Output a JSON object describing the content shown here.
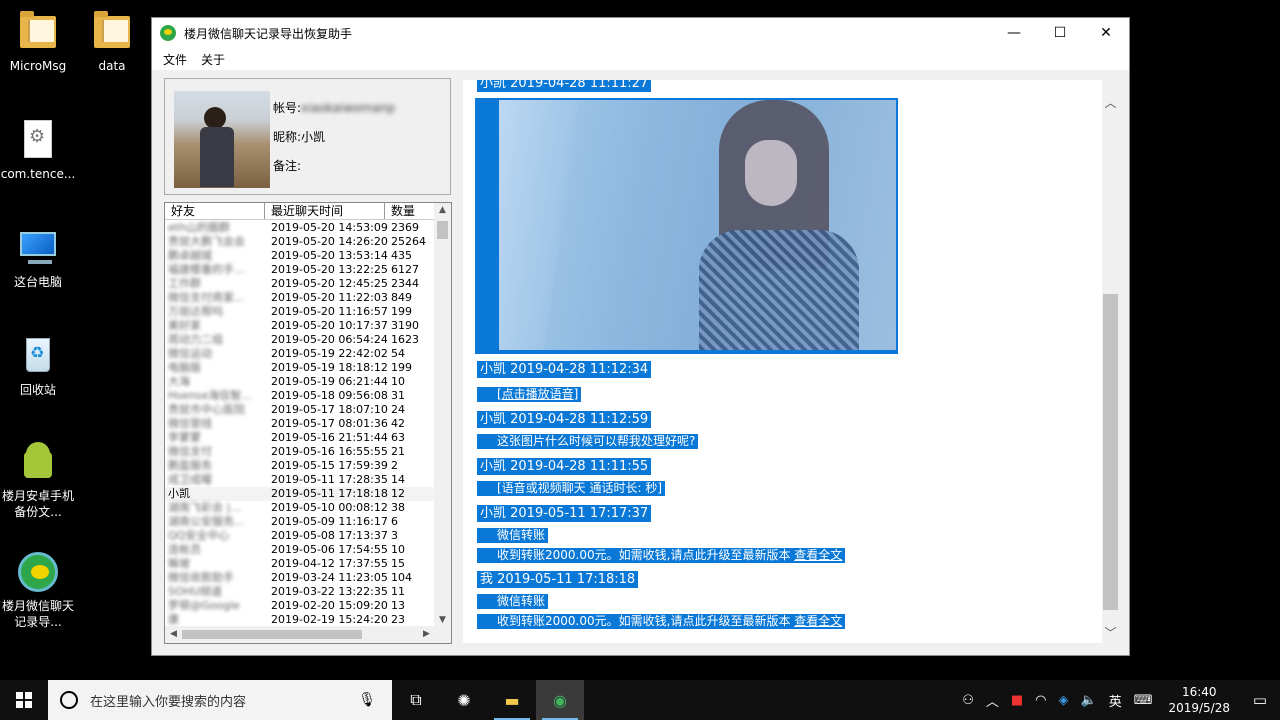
{
  "desktop": {
    "icons": [
      {
        "label": "MicroMsg",
        "icon": "folder-icon"
      },
      {
        "label": "data",
        "icon": "folder-icon"
      },
      {
        "label": "com.tence...",
        "icon": "file-icon"
      },
      {
        "label": "这台电脑",
        "icon": "computer-icon"
      },
      {
        "label": "回收站",
        "icon": "recycle-bin-icon"
      },
      {
        "label": "楼月安卓手机备份文...",
        "icon": "android-icon"
      },
      {
        "label": "楼月微信聊天记录导...",
        "icon": "wechat-recovery-icon"
      }
    ]
  },
  "window": {
    "title": "楼月微信聊天记录导出恢复助手",
    "controls": {
      "minimize": "—",
      "maximize": "☐",
      "close": "✕"
    },
    "menu": [
      "文件",
      "关于"
    ]
  },
  "profile": {
    "account_label": "帐号:",
    "account_value": "xiaokaiwomanp",
    "nickname_label": "昵称:",
    "nickname_value": "小凯",
    "remark_label": "备注:",
    "remark_value": ""
  },
  "friend_list": {
    "columns": [
      "好友",
      "最近聊天时间",
      "数量"
    ],
    "rows": [
      {
        "name": "eth山的圈群",
        "time": "2019-05-20 14:53:09",
        "count": "2369",
        "blurred": true
      },
      {
        "name": "贵就大鹏飞会会",
        "time": "2019-05-20 14:26:20",
        "count": "25264",
        "blurred": true
      },
      {
        "name": "鹏卓越城",
        "time": "2019-05-20 13:53:14",
        "count": "435",
        "blurred": true
      },
      {
        "name": "福建樱番的手...",
        "time": "2019-05-20 13:22:25",
        "count": "6127",
        "blurred": true
      },
      {
        "name": "工作群",
        "time": "2019-05-20 12:45:25",
        "count": "2344",
        "blurred": true
      },
      {
        "name": "微信支付商家...",
        "time": "2019-05-20 11:22:03",
        "count": "849",
        "blurred": true
      },
      {
        "name": "万丽达帮吗",
        "time": "2019-05-20 11:16:57",
        "count": "199",
        "blurred": true
      },
      {
        "name": "美好家",
        "time": "2019-05-20 10:17:37",
        "count": "3190",
        "blurred": true
      },
      {
        "name": "周动力二组",
        "time": "2019-05-20 06:54:24",
        "count": "1623",
        "blurred": true
      },
      {
        "name": "微信运动",
        "time": "2019-05-19 22:42:02",
        "count": "54",
        "blurred": true
      },
      {
        "name": "电脑版",
        "time": "2019-05-19 18:18:12",
        "count": "199",
        "blurred": true
      },
      {
        "name": "大海",
        "time": "2019-05-19 06:21:44",
        "count": "10",
        "blurred": true
      },
      {
        "name": "Hsense海信智...",
        "time": "2019-05-18 09:56:08",
        "count": "31",
        "blurred": true
      },
      {
        "name": "贵就市中心医院",
        "time": "2019-05-17 18:07:10",
        "count": "24",
        "blurred": true
      },
      {
        "name": "微信管线",
        "time": "2019-05-17 08:01:36",
        "count": "42",
        "blurred": true
      },
      {
        "name": "李蒙蒙",
        "time": "2019-05-16 21:51:44",
        "count": "63",
        "blurred": true
      },
      {
        "name": "微信支付",
        "time": "2019-05-16 16:55:55",
        "count": "21",
        "blurred": true
      },
      {
        "name": "鹏盈服务",
        "time": "2019-05-15 17:59:39",
        "count": "2",
        "blurred": true
      },
      {
        "name": "成卫成曜",
        "time": "2019-05-11 17:28:35",
        "count": "14",
        "blurred": true
      },
      {
        "name": "小凯",
        "time": "2019-05-11 17:18:18",
        "count": "12",
        "blurred": false,
        "selected": true
      },
      {
        "name": "湖南飞彩会 |...",
        "time": "2019-05-10 00:08:12",
        "count": "38",
        "blurred": true
      },
      {
        "name": "湖南公安服务...",
        "time": "2019-05-09 11:16:17",
        "count": "6",
        "blurred": true
      },
      {
        "name": "QQ安全中心",
        "time": "2019-05-08 17:13:37",
        "count": "3",
        "blurred": true
      },
      {
        "name": "连帐员",
        "time": "2019-05-06 17:54:55",
        "count": "10",
        "blurred": true
      },
      {
        "name": "嘛坡",
        "time": "2019-04-12 17:37:55",
        "count": "15",
        "blurred": true
      },
      {
        "name": "微信收款助手",
        "time": "2019-03-24 11:23:05",
        "count": "104",
        "blurred": true
      },
      {
        "name": "SOHU频道",
        "time": "2019-03-22 13:22:35",
        "count": "11",
        "blurred": true
      },
      {
        "name": "罗顿@Google",
        "time": "2019-02-20 15:09:20",
        "count": "13",
        "blurred": true
      },
      {
        "name": "康",
        "time": "2019-02-19 15:24:20",
        "count": "23",
        "blurred": true
      }
    ]
  },
  "chat": {
    "items": [
      {
        "kind": "header",
        "text": "小凯  2019-04-28 11:11:27"
      },
      {
        "kind": "header",
        "text": "小凯  2019-04-28 11:12:34"
      },
      {
        "kind": "link",
        "text": "[点击播放语音]"
      },
      {
        "kind": "header",
        "text": "小凯  2019-04-28 11:12:59"
      },
      {
        "kind": "text",
        "text": "这张图片什么时候可以帮我处理好呢?"
      },
      {
        "kind": "header",
        "text": "小凯  2019-04-28 11:11:55"
      },
      {
        "kind": "text",
        "text": "[语音或视频聊天  通话时长: 秒]"
      },
      {
        "kind": "header",
        "text": "小凯  2019-05-11 17:17:37"
      },
      {
        "kind": "text",
        "text": "微信转账"
      },
      {
        "kind": "transfer",
        "text": "收到转账2000.00元。如需收钱,请点此升级至最新版本",
        "link": "查看全文"
      },
      {
        "kind": "header",
        "text": "我  2019-05-11 17:18:18"
      },
      {
        "kind": "text",
        "text": "微信转账"
      },
      {
        "kind": "transfer",
        "text": "收到转账2000.00元。如需收钱,请点此升级至最新版本",
        "link": "查看全文"
      }
    ]
  },
  "taskbar": {
    "search_placeholder": "在这里输入你要搜索的内容",
    "tray": {
      "ime": "英",
      "time": "16:40",
      "date": "2019/5/28"
    }
  }
}
